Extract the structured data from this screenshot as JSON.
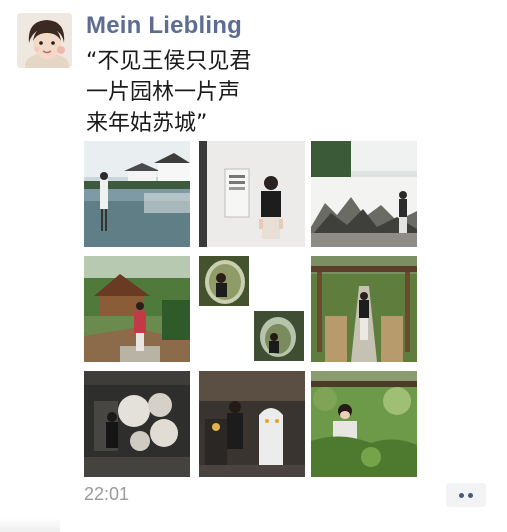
{
  "post": {
    "author": "Mein Liebling",
    "caption_lines": [
      "“不见王侯只见君",
      "一片园林一片声",
      "来年姑苏城”"
    ],
    "timestamp": "22:01",
    "photo_count": 9,
    "more_icon": "ellipsis-icon"
  },
  "colors": {
    "author_name": "#5d6d92",
    "timestamp": "#9a9a9a",
    "more_button_bg": "#f2f3f5",
    "more_button_dots": "#4b5a7a"
  }
}
